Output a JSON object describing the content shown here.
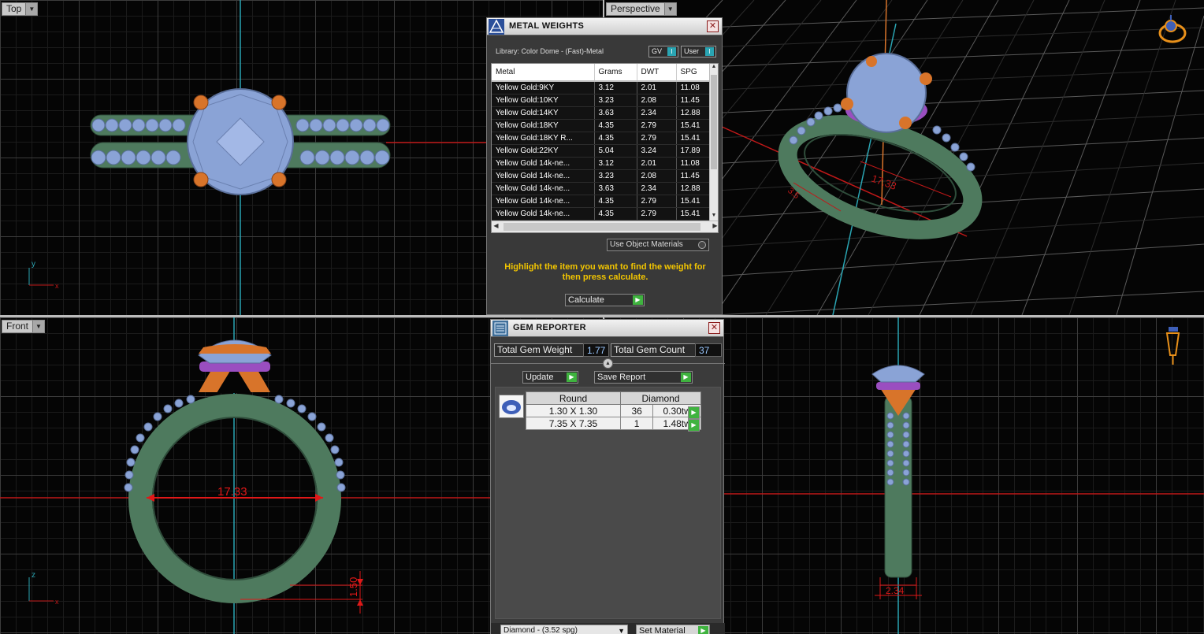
{
  "viewports": {
    "top": {
      "label": "Top"
    },
    "perspective": {
      "label": "Perspective"
    },
    "front": {
      "label": "Front"
    },
    "right": {
      "label": ""
    }
  },
  "dimensions": {
    "front_diameter": "17.33",
    "front_thickness": "1.50",
    "persp_diameter": "17.33",
    "persp_side": "3.5",
    "right_width": "2.34"
  },
  "axes": {
    "y": "y",
    "x": "x",
    "z": "z"
  },
  "metal_weights": {
    "title": "METAL WEIGHTS",
    "library": "Library: Color Dome - (Fast)-Metal",
    "toggle_gv": "GV",
    "toggle_user": "User",
    "columns": [
      "Metal",
      "Grams",
      "DWT",
      "SPG"
    ],
    "rows": [
      [
        "Yellow Gold:9KY",
        "3.12",
        "2.01",
        "11.08"
      ],
      [
        "Yellow Gold:10KY",
        "3.23",
        "2.08",
        "11.45"
      ],
      [
        "Yellow Gold:14KY",
        "3.63",
        "2.34",
        "12.88"
      ],
      [
        "Yellow Gold:18KY",
        "4.35",
        "2.79",
        "15.41"
      ],
      [
        "Yellow Gold:18KY R...",
        "4.35",
        "2.79",
        "15.41"
      ],
      [
        "Yellow Gold:22KY",
        "5.04",
        "3.24",
        "17.89"
      ],
      [
        "Yellow Gold 14k-ne...",
        "3.12",
        "2.01",
        "11.08"
      ],
      [
        "Yellow Gold 14k-ne...",
        "3.23",
        "2.08",
        "11.45"
      ],
      [
        "Yellow Gold 14k-ne...",
        "3.63",
        "2.34",
        "12.88"
      ],
      [
        "Yellow Gold 14k-ne...",
        "4.35",
        "2.79",
        "15.41"
      ],
      [
        "Yellow Gold 14k-ne...",
        "4.35",
        "2.79",
        "15.41"
      ]
    ],
    "material_select": "Use Object Materials",
    "hint": "Highlight the item you want to find the weight for then press calculate.",
    "calculate_label": "Calculate"
  },
  "gem_reporter": {
    "title": "GEM REPORTER",
    "total_weight_label": "Total Gem Weight",
    "total_weight_value": "1.77",
    "total_count_label": "Total Gem Count",
    "total_count_value": "37",
    "update_label": "Update",
    "save_report_label": "Save Report",
    "table_headers": [
      "Round",
      "Diamond"
    ],
    "rows": [
      {
        "size": "1.30 X 1.30",
        "count": "36",
        "weight": "0.30tw"
      },
      {
        "size": "7.35 X 7.35",
        "count": "1",
        "weight": "1.48tw"
      }
    ],
    "material_select": "Diamond - (3.52 spg)",
    "set_material_label": "Set Material"
  },
  "colors": {
    "band": "#4e7a5e",
    "stone": "#8aa3d6",
    "prong": "#d8742a",
    "collar": "#9a4ec0",
    "dim": "#e01818",
    "axis_cyan": "#2aa5b3",
    "hint_yellow": "#f2c500"
  },
  "icons": [
    "metal-weights-app-icon",
    "gem-reporter-app-icon",
    "close-icon",
    "view-cube-icon",
    "play-arrow-icon",
    "chevron-down-icon"
  ]
}
